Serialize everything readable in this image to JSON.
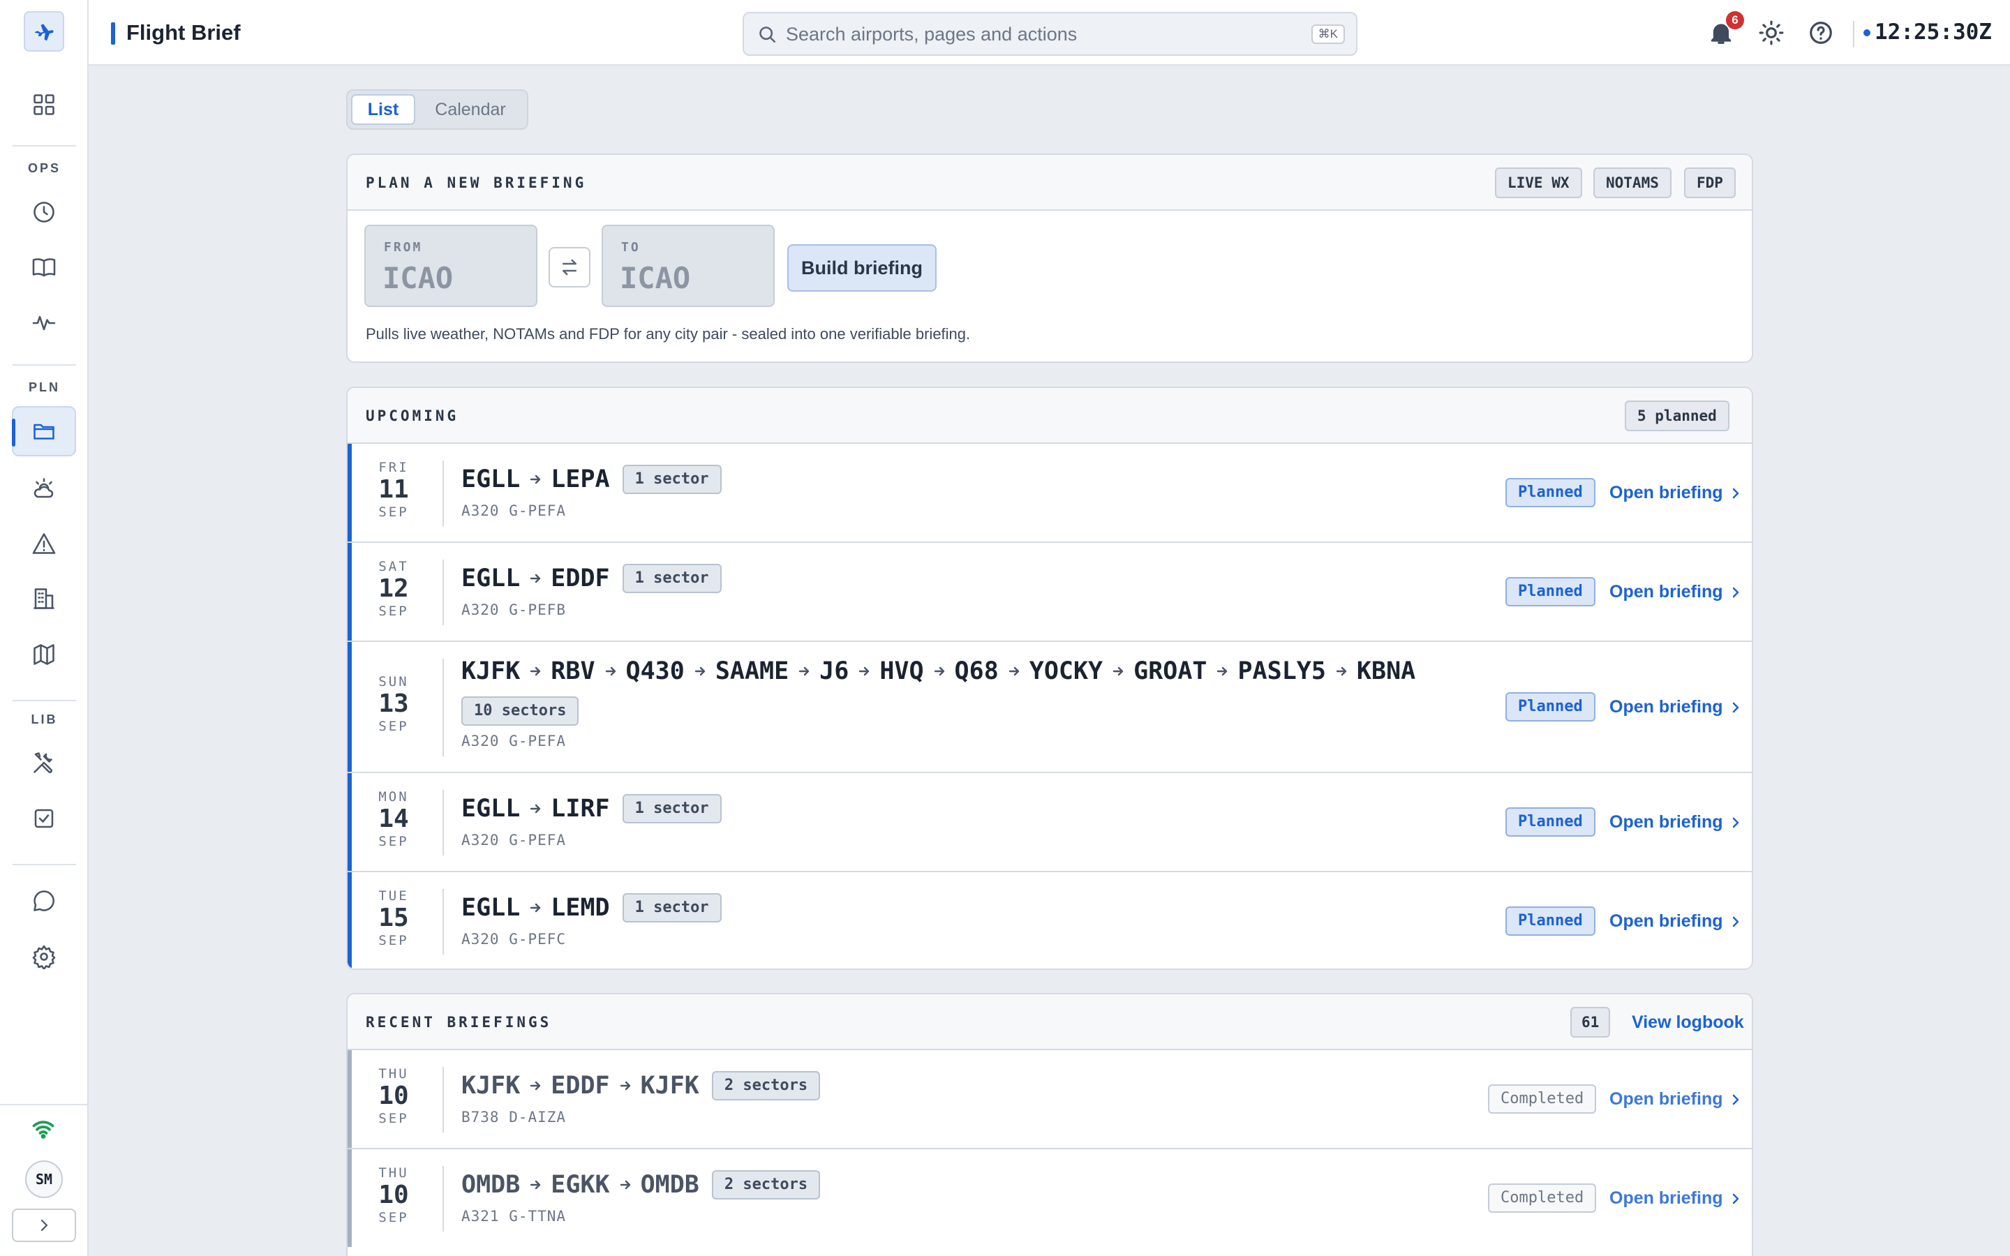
{
  "app": {
    "title": "Flight Brief"
  },
  "header": {
    "search_placeholder": "Search airports, pages and actions",
    "search_shortcut": "⌘K",
    "notification_count": "6",
    "clock": "12:25:30Z",
    "icons": [
      "bell-icon",
      "sun-icon",
      "help-icon"
    ]
  },
  "sidebar": {
    "sections": {
      "ops": "OPS",
      "pln": "PLN",
      "lib": "LIB"
    },
    "user_initials": "SM",
    "active_item": "briefings"
  },
  "view_toggle": {
    "list": "List",
    "calendar": "Calendar",
    "selected": "List"
  },
  "plan": {
    "heading": "PLAN A NEW BRIEFING",
    "chips": [
      "LIVE WX",
      "NOTAMS",
      "FDP"
    ],
    "from_label": "FROM",
    "to_label": "TO",
    "from_placeholder": "ICAO",
    "to_placeholder": "ICAO",
    "build_label": "Build briefing",
    "hint": "Pulls live weather, NOTAMs and FDP for any city pair - sealed into one verifiable briefing."
  },
  "upcoming": {
    "heading": "UPCOMING",
    "count_label": "5 planned",
    "rows": [
      {
        "dow": "FRI",
        "day": "11",
        "mon": "SEP",
        "route": [
          "EGLL",
          "LEPA"
        ],
        "sectors": "1 sector",
        "aircraft": "A320 G-PEFA",
        "status": "Planned",
        "action": "Open briefing"
      },
      {
        "dow": "SAT",
        "day": "12",
        "mon": "SEP",
        "route": [
          "EGLL",
          "EDDF"
        ],
        "sectors": "1 sector",
        "aircraft": "A320 G-PEFB",
        "status": "Planned",
        "action": "Open briefing"
      },
      {
        "dow": "SUN",
        "day": "13",
        "mon": "SEP",
        "route": [
          "KJFK",
          "RBV",
          "Q430",
          "SAAME",
          "J6",
          "HVQ",
          "Q68",
          "YOCKY",
          "GROAT",
          "PASLY5",
          "KBNA"
        ],
        "sectors": "10 sectors",
        "aircraft": "A320 G-PEFA",
        "status": "Planned",
        "action": "Open briefing"
      },
      {
        "dow": "MON",
        "day": "14",
        "mon": "SEP",
        "route": [
          "EGLL",
          "LIRF"
        ],
        "sectors": "1 sector",
        "aircraft": "A320 G-PEFA",
        "status": "Planned",
        "action": "Open briefing"
      },
      {
        "dow": "TUE",
        "day": "15",
        "mon": "SEP",
        "route": [
          "EGLL",
          "LEMD"
        ],
        "sectors": "1 sector",
        "aircraft": "A320 G-PEFC",
        "status": "Planned",
        "action": "Open briefing"
      }
    ]
  },
  "recent": {
    "heading": "RECENT BRIEFINGS",
    "count": "61",
    "logbook_label": "View logbook",
    "rows": [
      {
        "dow": "THU",
        "day": "10",
        "mon": "SEP",
        "route": [
          "KJFK",
          "EDDF",
          "KJFK"
        ],
        "sectors": "2 sectors",
        "aircraft": "B738 D-AIZA",
        "status": "Completed",
        "action": "Open briefing"
      },
      {
        "dow": "THU",
        "day": "10",
        "mon": "SEP",
        "route": [
          "OMDB",
          "EGKK",
          "OMDB"
        ],
        "sectors": "2 sectors",
        "aircraft": "A321 G-TTNA",
        "status": "Completed",
        "action": "Open briefing"
      }
    ]
  }
}
